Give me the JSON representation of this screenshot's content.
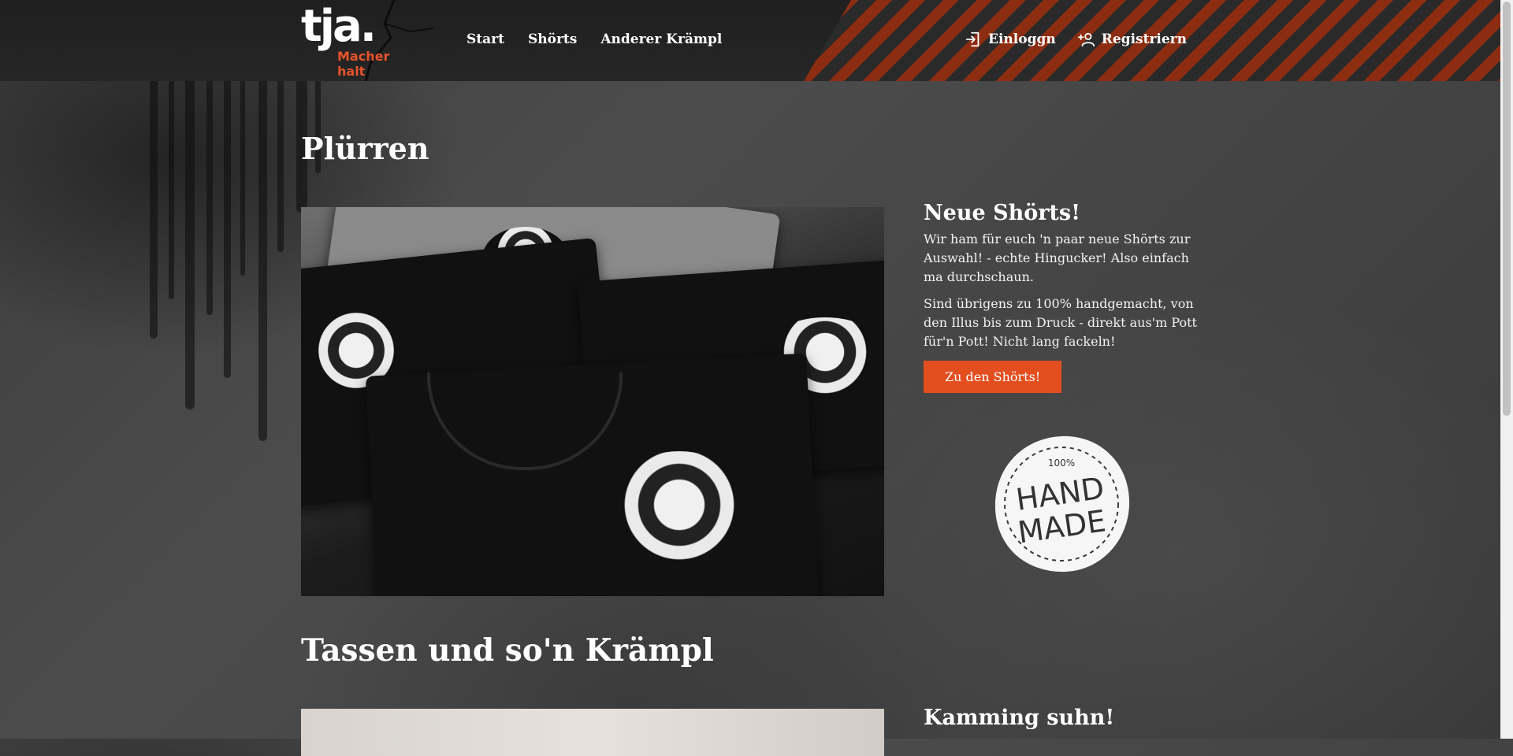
{
  "header": {
    "logo_text": "tja.",
    "logo_tagline": "Macher halt",
    "nav": [
      {
        "label": "Start"
      },
      {
        "label": "Shörts"
      },
      {
        "label": "Anderer Krämpl"
      }
    ],
    "login_label": "Einloggn",
    "register_label": "Registriern"
  },
  "main": {
    "page_title": "Plürren",
    "feature": {
      "heading": "Neue Shörts!",
      "paragraph_1": "Wir ham für euch 'n paar neue Shörts zur Auswahl! - echte Hingucker! Also einfach ma durchschaun.",
      "paragraph_2": "Sind übrigens zu 100% handgemacht, von den Illus bis zum Druck - direkt aus'm Pott für'n Pott! Nicht lang fackeln!",
      "cta_label": "Zu den Shörts!"
    },
    "badge": {
      "percent": "100%",
      "line_1": "HAND",
      "line_2": "MADE"
    },
    "section_2_title": "Tassen und so'n Krämpl",
    "section_2_heading": "Kamming suhn!"
  },
  "colors": {
    "accent": "#e34e1f",
    "stripe": "#8c2d12",
    "header_bg": "#232323"
  },
  "icons": {
    "login": "login-icon",
    "register": "add-user-icon"
  }
}
